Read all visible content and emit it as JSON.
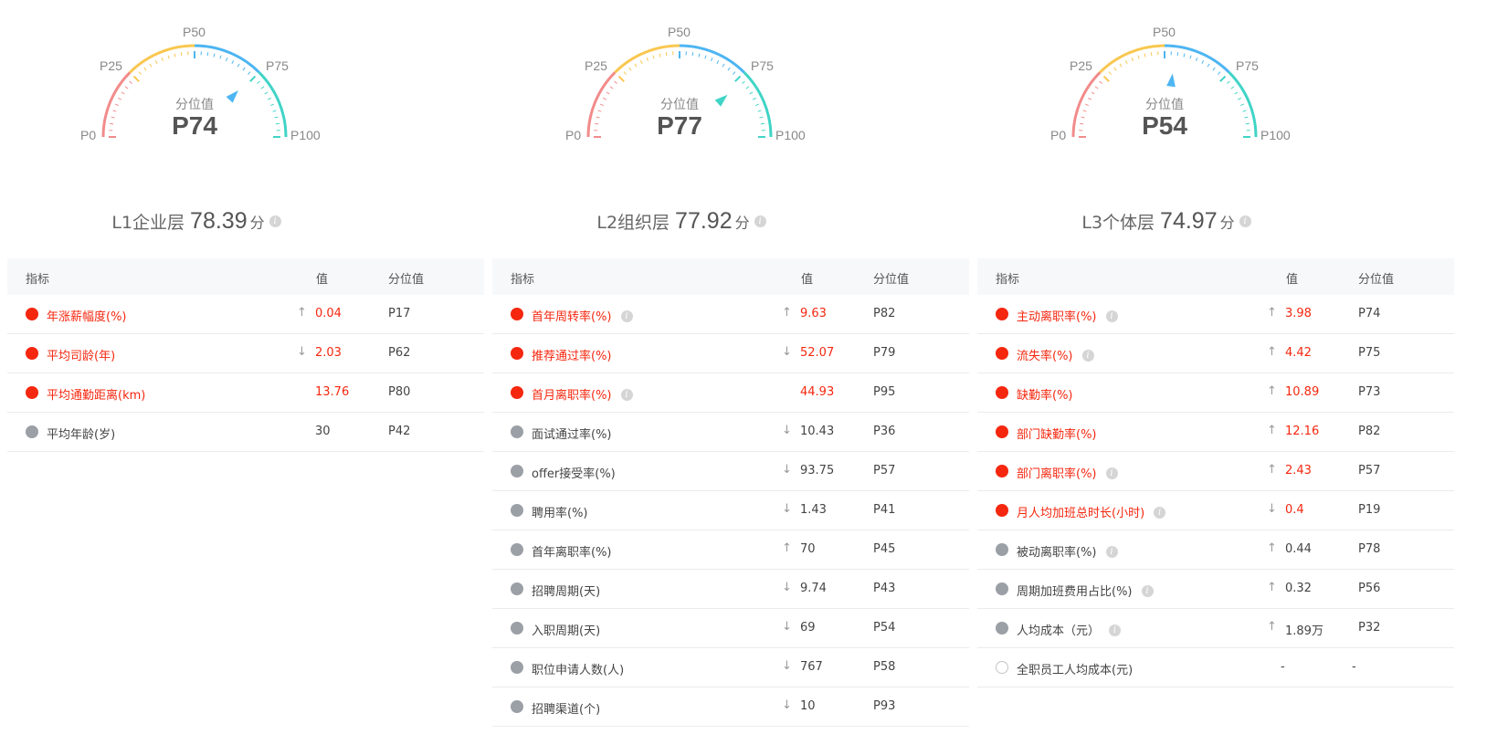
{
  "gauge_ticks": [
    "P0",
    "P25",
    "P50",
    "P75",
    "P100"
  ],
  "gauge_caption": "分位值",
  "table_headers": {
    "indicator": "指标",
    "value": "值",
    "percentile": "分位值"
  },
  "colors": {
    "red": "#f5270f",
    "gray": "#9b9fa6",
    "blue": "#4db5f2",
    "teal": "#40d4c6",
    "yellow": "#f9c74f",
    "pink": "#f28b8b"
  },
  "panels": [
    {
      "gauge_value": "P74",
      "gauge_percent": 74,
      "pointer_color": "#4db5f2",
      "layer": "L1企业层",
      "score": "78.39",
      "unit": "分",
      "rows": [
        {
          "status": "red",
          "name": "年涨薪幅度(%)",
          "info": false,
          "trend": "up",
          "value": "0.04",
          "percentile": "P17"
        },
        {
          "status": "red",
          "name": "平均司龄(年)",
          "info": false,
          "trend": "down",
          "value": "2.03",
          "percentile": "P62"
        },
        {
          "status": "red",
          "name": "平均通勤距离(km)",
          "info": false,
          "trend": "none",
          "value": "13.76",
          "percentile": "P80"
        },
        {
          "status": "gray",
          "name": "平均年龄(岁)",
          "info": false,
          "trend": "none",
          "value": "30",
          "percentile": "P42"
        }
      ]
    },
    {
      "gauge_value": "P77",
      "gauge_percent": 77,
      "pointer_color": "#40d4c6",
      "layer": "L2组织层",
      "score": "77.92",
      "unit": "分",
      "rows": [
        {
          "status": "red",
          "name": "首年周转率(%)",
          "info": true,
          "trend": "up",
          "value": "9.63",
          "percentile": "P82"
        },
        {
          "status": "red",
          "name": "推荐通过率(%)",
          "info": false,
          "trend": "down",
          "value": "52.07",
          "percentile": "P79"
        },
        {
          "status": "red",
          "name": "首月离职率(%)",
          "info": true,
          "trend": "none",
          "value": "44.93",
          "percentile": "P95"
        },
        {
          "status": "gray",
          "name": "面试通过率(%)",
          "info": false,
          "trend": "down",
          "value": "10.43",
          "percentile": "P36"
        },
        {
          "status": "gray",
          "name": "offer接受率(%)",
          "info": false,
          "trend": "down",
          "value": "93.75",
          "percentile": "P57"
        },
        {
          "status": "gray",
          "name": "聘用率(%)",
          "info": false,
          "trend": "down",
          "value": "1.43",
          "percentile": "P41"
        },
        {
          "status": "gray",
          "name": "首年离职率(%)",
          "info": false,
          "trend": "up",
          "value": "70",
          "percentile": "P45"
        },
        {
          "status": "gray",
          "name": "招聘周期(天)",
          "info": false,
          "trend": "down",
          "value": "9.74",
          "percentile": "P43"
        },
        {
          "status": "gray",
          "name": "入职周期(天)",
          "info": false,
          "trend": "down",
          "value": "69",
          "percentile": "P54"
        },
        {
          "status": "gray",
          "name": "职位申请人数(人)",
          "info": false,
          "trend": "down",
          "value": "767",
          "percentile": "P58"
        },
        {
          "status": "gray",
          "name": "招聘渠道(个)",
          "info": false,
          "trend": "down",
          "value": "10",
          "percentile": "P93"
        }
      ]
    },
    {
      "gauge_value": "P54",
      "gauge_percent": 54,
      "pointer_color": "#4db5f2",
      "layer": "L3个体层",
      "score": "74.97",
      "unit": "分",
      "rows": [
        {
          "status": "red",
          "name": "主动离职率(%)",
          "info": true,
          "trend": "up",
          "value": "3.98",
          "percentile": "P74"
        },
        {
          "status": "red",
          "name": "流失率(%)",
          "info": true,
          "trend": "up",
          "value": "4.42",
          "percentile": "P75"
        },
        {
          "status": "red",
          "name": "缺勤率(%)",
          "info": false,
          "trend": "up",
          "value": "10.89",
          "percentile": "P73"
        },
        {
          "status": "red",
          "name": "部门缺勤率(%)",
          "info": false,
          "trend": "up",
          "value": "12.16",
          "percentile": "P82"
        },
        {
          "status": "red",
          "name": "部门离职率(%)",
          "info": true,
          "trend": "up",
          "value": "2.43",
          "percentile": "P57"
        },
        {
          "status": "red",
          "name": "月人均加班总时长(小时)",
          "info": true,
          "trend": "down",
          "value": "0.4",
          "percentile": "P19"
        },
        {
          "status": "gray",
          "name": "被动离职率(%)",
          "info": true,
          "trend": "up",
          "value": "0.44",
          "percentile": "P78"
        },
        {
          "status": "gray",
          "name": "周期加班费用占比(%)",
          "info": true,
          "trend": "up",
          "value": "0.32",
          "percentile": "P56"
        },
        {
          "status": "gray",
          "name": "人均成本（元）",
          "info": true,
          "trend": "up",
          "value": "1.89万",
          "percentile": "P32"
        },
        {
          "status": "empty",
          "name": "全职员工人均成本(元)",
          "info": false,
          "trend": "none",
          "value": "-",
          "percentile": "-"
        }
      ]
    }
  ]
}
